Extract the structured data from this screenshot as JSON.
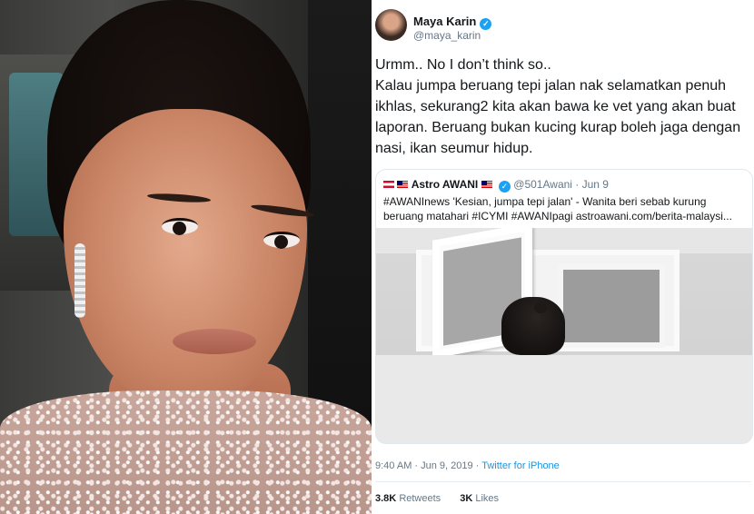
{
  "tweet": {
    "author_name": "Maya Karin",
    "author_handle": "@maya_karin",
    "text": "Urmm.. No I don’t think so..\nKalau jumpa beruang tepi jalan nak selamatkan penuh ikhlas, sekurang2 kita akan bawa ke vet yang akan buat laporan. Beruang bukan kucing kurap boleh jaga dengan nasi, ikan seumur hidup.",
    "quoted": {
      "name": "Astro AWANI",
      "handle": "@501Awani",
      "date": "· Jun 9",
      "text": "#AWANInews 'Kesian, jumpa tepi jalan' - Wanita beri sebab kurung beruang matahari #ICYMI #AWANIpagi astroawani.com/berita-malaysi..."
    },
    "timestamp": "9:40 AM · Jun 9, 2019 · ",
    "source": "Twitter for iPhone",
    "retweets_count": "3.8K",
    "retweets_label": "Retweets",
    "likes_count": "3K",
    "likes_label": "Likes"
  },
  "icons": {
    "verified": "verified-badge-icon",
    "verified_glyph": "✓"
  }
}
